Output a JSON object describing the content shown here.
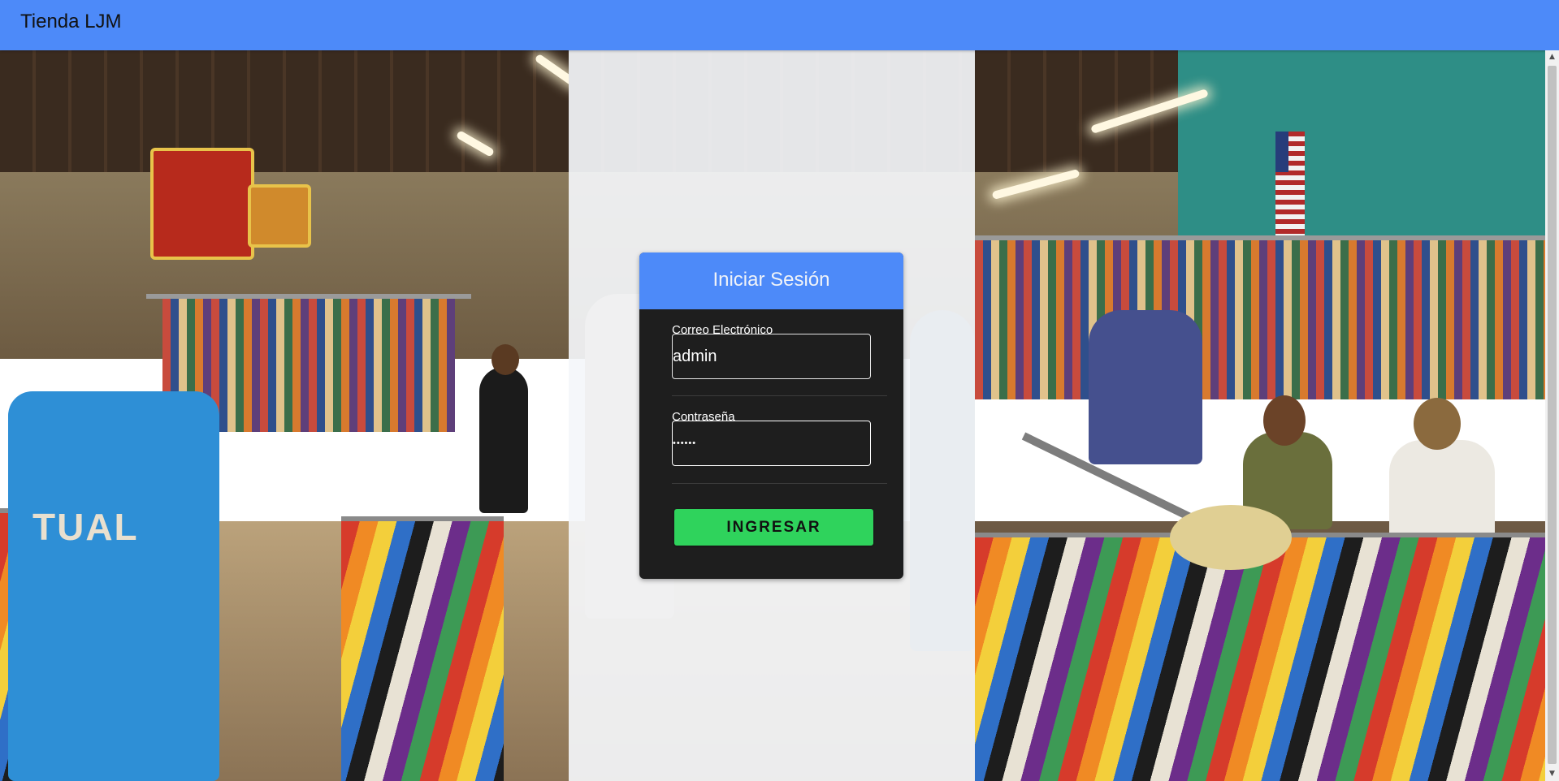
{
  "navbar": {
    "brand": "Tienda LJM",
    "color": "#4d8af9"
  },
  "login": {
    "title": "Iniciar Sesión",
    "email": {
      "label": "Correo Electrónico",
      "value": "admin"
    },
    "password": {
      "label": "Contraseña",
      "value": "••••••"
    },
    "submit_label": "INGRESAR",
    "submit_color": "#2fd35c"
  },
  "icons": {
    "scroll_up": "scroll-up-icon",
    "scroll_down": "scroll-down-icon"
  }
}
